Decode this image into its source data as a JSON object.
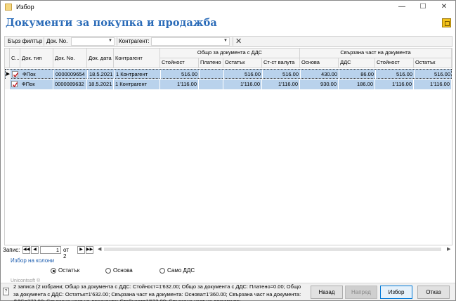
{
  "window": {
    "title": "Избор"
  },
  "page": {
    "title": "Документи за покупка и продажба"
  },
  "filterbar": {
    "quick_filter": "Бърз филтър",
    "doc_no_label": "Док. No.",
    "contractor_label": "Контрагент:"
  },
  "grid": {
    "headers": {
      "c": "С...",
      "doc_type": "Док. тип",
      "doc_no": "Док. No.",
      "doc_date": "Док. дата",
      "contractor": "Контрагент",
      "group_total": "Общо за документа с ДДС",
      "group_linked": "Свързана част на документа",
      "value": "Стойност",
      "paid": "Платено",
      "remainder": "Остатък",
      "value_currency": "Ст-ст валута",
      "base": "Основа",
      "vat": "ДДС",
      "linked_value": "Стойност",
      "linked_remainder": "Остатък"
    },
    "rows": [
      {
        "doc_type": "ФПок",
        "doc_no": "0000009654",
        "doc_date": "18.5.2021",
        "contractor": "1 Контрагент",
        "value": "516.00",
        "paid": "",
        "remainder": "516.00",
        "value_currency": "516.00",
        "base": "430.00",
        "vat": "86.00",
        "linked_value": "516.00",
        "linked_remainder": "516.00"
      },
      {
        "doc_type": "ФПок",
        "doc_no": "0000089632",
        "doc_date": "18.5.2021",
        "contractor": "1 Контрагент",
        "value": "1'116.00",
        "paid": "",
        "remainder": "1'116.00",
        "value_currency": "1'116.00",
        "base": "930.00",
        "vat": "186.00",
        "linked_value": "1'116.00",
        "linked_remainder": "1'116.00"
      }
    ]
  },
  "navigator": {
    "label": "Запис:",
    "current": "1",
    "of_text": "от 2"
  },
  "column_link": "Избор на колони",
  "radios": [
    {
      "label": "Остатък",
      "selected": true
    },
    {
      "label": "Основа",
      "selected": false
    },
    {
      "label": "Само ДДС",
      "selected": false
    }
  ],
  "watermark": "Unicontsoft ®",
  "summary": "2 записа (2 избрани; Общо за документа с ДДС: Стойност=1'632.00; Общо за документа с ДДС: Платено=0.00; Общо за документа с ДДС: Остатък=1'632.00; Свързана част на документа: Основа=1'360.00; Свързана част на документа: ДДС=272.00; Свързана част на документа: Стойност=1'632.00; Свързана част на документа:",
  "buttons": {
    "back": "Назад",
    "next": "Напред",
    "select": "Избор",
    "cancel": "Отказ"
  }
}
